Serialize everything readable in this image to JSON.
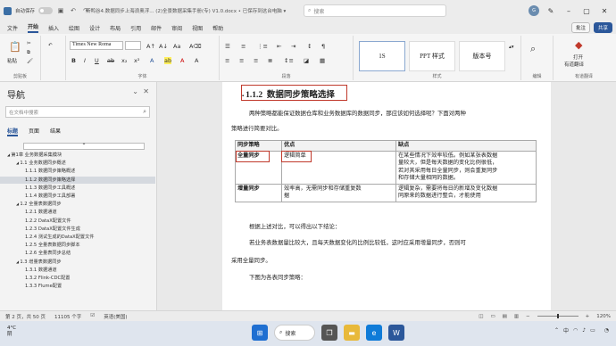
{
  "titlebar": {
    "autosave_label": "自动保存",
    "autosave_state": "关",
    "doc_title": "斯鸭谷4.数据同步上海浪奥浮... (2)全景数据采集手册(专) V1.0.docx • 已保存到这台电脑 ▾",
    "search_placeholder": "搜索",
    "user_initial": "G"
  },
  "menu": {
    "items": [
      "文件",
      "开始",
      "插入",
      "绘图",
      "设计",
      "布局",
      "引用",
      "邮件",
      "审阅",
      "视图",
      "帮助"
    ],
    "active": "开始",
    "comments_label": "批注",
    "share_label": "共享"
  },
  "ribbon": {
    "clipboard": {
      "paste_label": "粘贴",
      "group_label": "剪贴板"
    },
    "font": {
      "font_name": "Times New Roma",
      "group_label": "字体"
    },
    "paragraph": {
      "group_label": "段落"
    },
    "styles": {
      "cards": [
        "1S",
        "PPT 样式",
        "版本号"
      ],
      "group_label": "样式"
    },
    "editing": {
      "group_label": "编辑"
    },
    "addins": {
      "open_label": "打开",
      "translate_label": "有道翻译",
      "group_label": "有道翻译"
    }
  },
  "nav": {
    "title": "导航",
    "search_placeholder": "在文档中搜索",
    "tabs": [
      "标题",
      "页面",
      "结果"
    ],
    "items": [
      {
        "text": "第1章 业务数据采集模块",
        "level": 0,
        "selected": false
      },
      {
        "text": "1.1 业务数据同步概述",
        "level": 1,
        "selected": false
      },
      {
        "text": "1.1.1 数据同步策略概述",
        "level": 2,
        "selected": false
      },
      {
        "text": "1.1.2 数据同步策略选择",
        "level": 2,
        "selected": true
      },
      {
        "text": "1.1.3 数据同步工具概述",
        "level": 2,
        "selected": false
      },
      {
        "text": "1.1.4 数据同步工具部署",
        "level": 2,
        "selected": false
      },
      {
        "text": "1.2 全量表数据同步",
        "level": 1,
        "selected": false
      },
      {
        "text": "1.2.1 数据通道",
        "level": 2,
        "selected": false
      },
      {
        "text": "1.2.2 DataX配置文件",
        "level": 2,
        "selected": false
      },
      {
        "text": "1.2.3 DataX配置文件生成",
        "level": 2,
        "selected": false
      },
      {
        "text": "1.2.4 测试生成的DataX配置文件",
        "level": 2,
        "selected": false
      },
      {
        "text": "1.2.5 全量表数据同步脚本",
        "level": 2,
        "selected": false
      },
      {
        "text": "1.2.6 全量表同步总结",
        "level": 2,
        "selected": false
      },
      {
        "text": "1.3 增量表数据同步",
        "level": 1,
        "selected": false
      },
      {
        "text": "1.3.1 数据通道",
        "level": 2,
        "selected": false
      },
      {
        "text": "1.3.2 Flink-CDC配置",
        "level": 2,
        "selected": false
      },
      {
        "text": "1.3.3 Flume配置",
        "level": 2,
        "selected": false
      }
    ]
  },
  "document": {
    "heading_number": "1.1.2",
    "heading_text": "数据同步策略选择",
    "intro_line1": "两种策略都能保证数据仓库和业务数据库的数据同步，那应该如何选择呢？下面对两种",
    "intro_line2": "策略进行简要对比。",
    "table": {
      "headers": [
        "同步策略",
        "优点",
        "缺点"
      ],
      "rows": [
        {
          "strategy": "全量同步",
          "pro": "逻辑简单",
          "con_lines": [
            "在某些情况下效率较低。例如某张表数据",
            "量较大，但是每天数据的变化比例很低，",
            "若对其采用每日全量同步，则会重复同步",
            "和存储大量相同的数据。"
          ]
        },
        {
          "strategy": "增量同步",
          "pro_lines": [
            "效率高，无需同步和存储重复数",
            "据"
          ],
          "con_lines": [
            "逻辑复杂，需要将每日的新增及变化数据",
            "同原来的数据进行整合，才能使用"
          ]
        }
      ]
    },
    "conclusion": "根据上述对比，可以得出以下结论：",
    "rule_line1": "若业务表数据量比较大，且每天数据变化的比例比较低，这时应采用增量同步，否则可",
    "rule_line2": "采用全量同步。",
    "next_line": "下图为各表同步策略："
  },
  "statusbar": {
    "page": "第 2 页，共 50 页",
    "words": "11105 个字",
    "lang": "英语(美国)",
    "zoom": "120%"
  },
  "taskbar": {
    "temp": "4°C",
    "weather": "阴",
    "search_label": "搜索",
    "lang": "中",
    "time": "",
    "date": ""
  }
}
